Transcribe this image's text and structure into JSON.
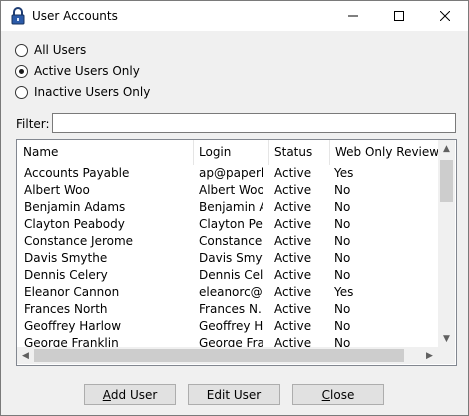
{
  "window": {
    "title": "User Accounts",
    "controls": {
      "minimize": "—",
      "maximize": "☐",
      "close": "✕"
    }
  },
  "filters": {
    "options": [
      {
        "label": "All Users",
        "checked": false
      },
      {
        "label": "Active Users Only",
        "checked": true
      },
      {
        "label": "Inactive Users Only",
        "checked": false
      }
    ]
  },
  "filter": {
    "label": "Filter:",
    "value": "",
    "placeholder": ""
  },
  "table": {
    "columns": [
      "Name",
      "Login",
      "Status",
      "Web Only Reviewer"
    ],
    "rows": [
      [
        "Accounts Payable",
        "ap@paperl...",
        "Active",
        "Yes"
      ],
      [
        "Albert Woo",
        "Albert Woo",
        "Active",
        "No"
      ],
      [
        "Benjamin Adams",
        "Benjamin A...",
        "Active",
        "No"
      ],
      [
        "Clayton Peabody",
        "Clayton Pe...",
        "Active",
        "No"
      ],
      [
        "Constance Jerome",
        "Constance ...",
        "Active",
        "No"
      ],
      [
        "Davis Smythe",
        "Davis Smyt...",
        "Active",
        "No"
      ],
      [
        "Dennis Celery",
        "Dennis Cel...",
        "Active",
        "No"
      ],
      [
        "Eleanor Cannon",
        "eleanorc@...",
        "Active",
        "Yes"
      ],
      [
        "Frances North",
        "Frances N...",
        "Active",
        "No"
      ],
      [
        "Geoffrey Harlow",
        "Geoffrey H...",
        "Active",
        "No"
      ],
      [
        "George Franklin",
        "George Fra...",
        "Active",
        "No"
      ]
    ]
  },
  "buttons": {
    "add": {
      "mnemonic": "A",
      "rest": "dd User"
    },
    "edit": {
      "mnemonic": "",
      "rest": "Edit User"
    },
    "close": {
      "mnemonic": "C",
      "rest": "lose"
    }
  },
  "colors": {
    "window_bg": "#f0f0f0",
    "list_bg": "#ffffff",
    "border": "#828790"
  }
}
